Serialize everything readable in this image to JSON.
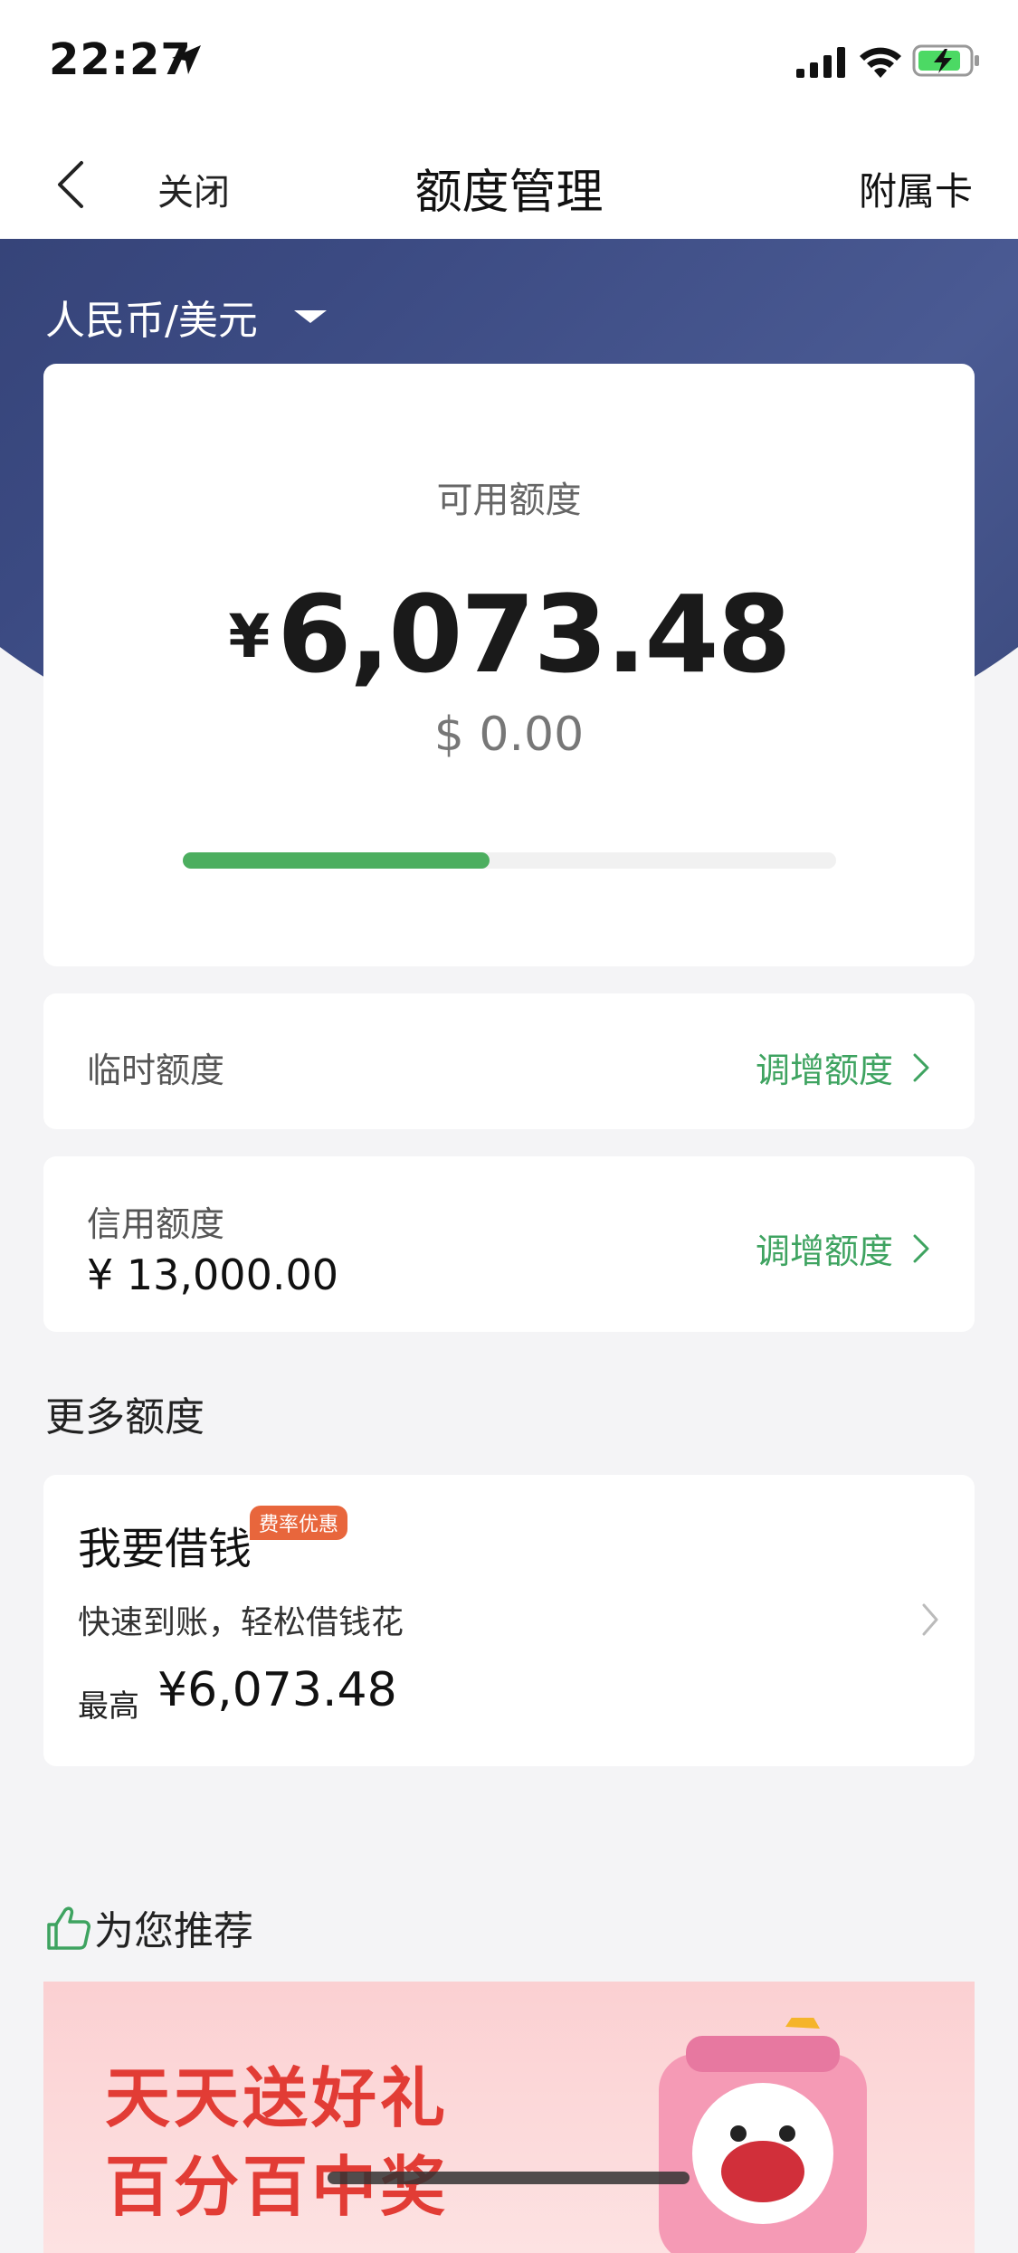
{
  "status_bar": {
    "time": "22:27"
  },
  "nav": {
    "close_label": "关闭",
    "title": "额度管理",
    "right_label": "附属卡"
  },
  "currency_selector": {
    "label": "人民币/美元"
  },
  "available": {
    "label": "可用额度",
    "currency_symbol": "¥",
    "amount": "6,073.48",
    "usd_amount": "$ 0.00",
    "usage_fraction": 0.47
  },
  "temporary_limit": {
    "label": "临时额度",
    "action": "调增额度"
  },
  "credit_limit": {
    "label": "信用额度",
    "value": "¥ 13,000.00",
    "action": "调增额度"
  },
  "more_limits": {
    "title": "更多额度"
  },
  "loan": {
    "title": "我要借钱",
    "badge": "费率优惠",
    "description": "快速到账，轻松借钱花",
    "max_label": "最高",
    "max_value": "¥6,073.48"
  },
  "recommend": {
    "title": "为您推荐",
    "banner_line1": "天天送好礼",
    "banner_line2": "百分百中奖"
  },
  "colors": {
    "accent_green": "#3ea360",
    "hero_blue": "#3b4a82",
    "badge_orange": "#e8663c",
    "banner_red": "#e23c35"
  }
}
